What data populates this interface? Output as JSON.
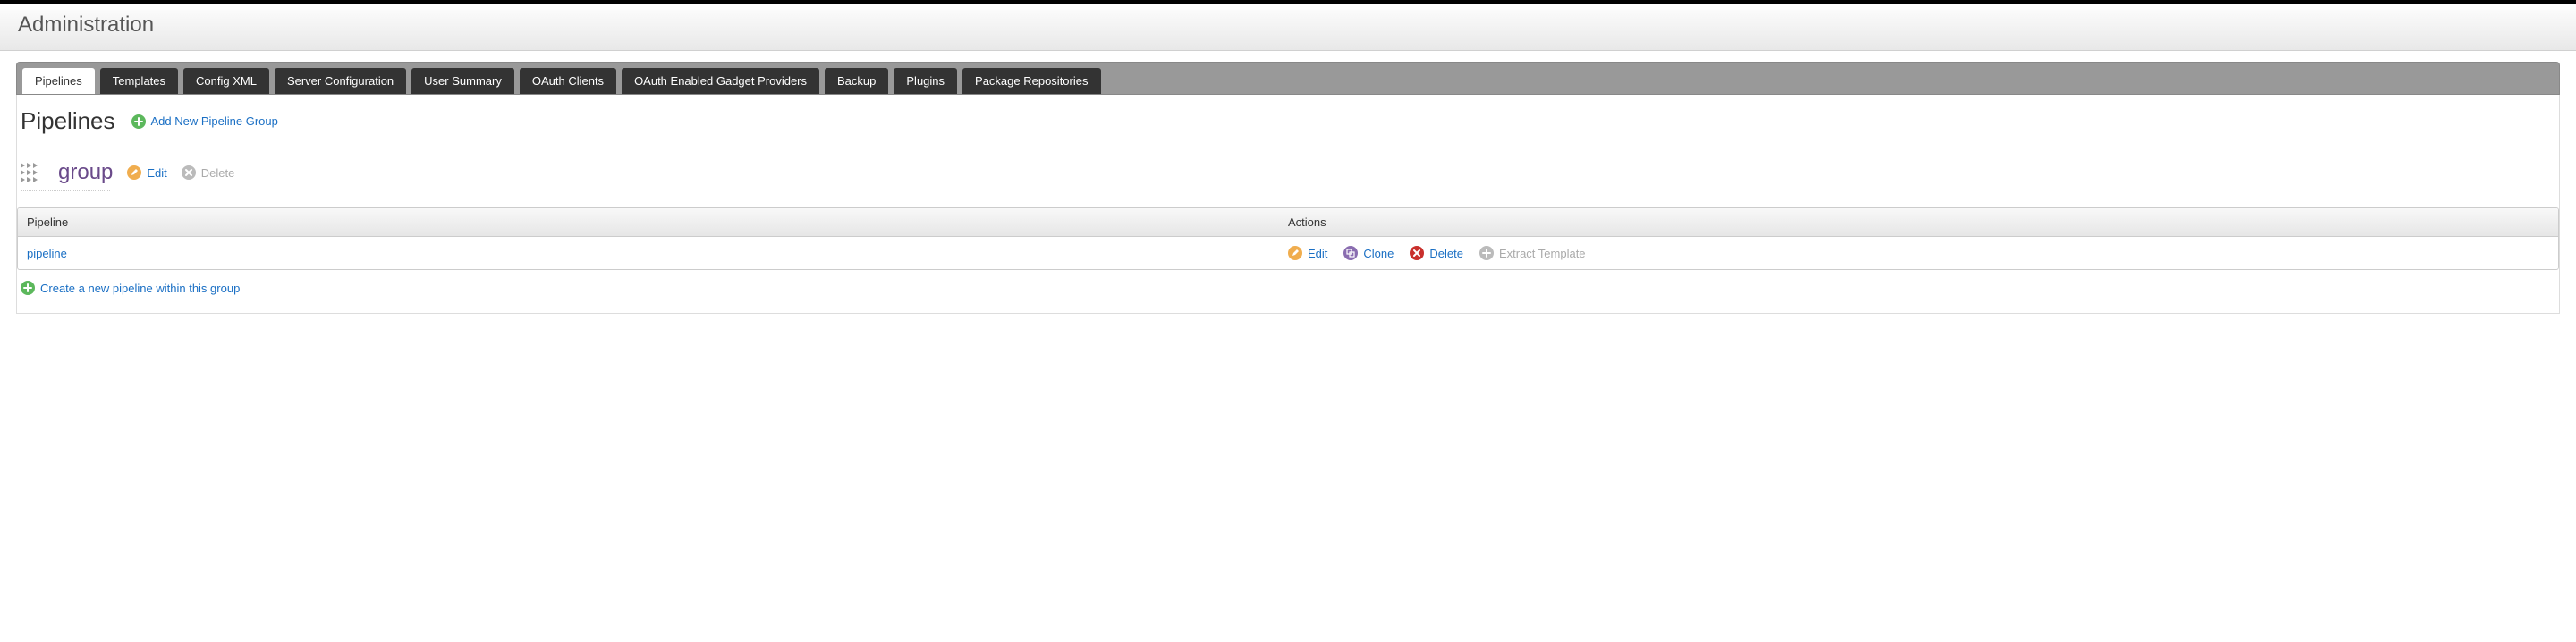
{
  "header": {
    "title": "Administration"
  },
  "tabs": [
    {
      "label": "Pipelines",
      "active": true
    },
    {
      "label": "Templates"
    },
    {
      "label": "Config XML"
    },
    {
      "label": "Server Configuration"
    },
    {
      "label": "User Summary"
    },
    {
      "label": "OAuth Clients"
    },
    {
      "label": "OAuth Enabled Gadget Providers"
    },
    {
      "label": "Backup"
    },
    {
      "label": "Plugins"
    },
    {
      "label": "Package Repositories"
    }
  ],
  "page": {
    "title": "Pipelines",
    "add_group_label": "Add New Pipeline Group"
  },
  "group": {
    "name": "group",
    "edit_label": "Edit",
    "delete_label": "Delete"
  },
  "table": {
    "headers": {
      "pipeline": "Pipeline",
      "actions": "Actions"
    },
    "rows": [
      {
        "name": "pipeline",
        "edit": "Edit",
        "clone": "Clone",
        "delete": "Delete",
        "extract": "Extract Template"
      }
    ]
  },
  "footer": {
    "create_label": "Create a new pipeline within this group"
  }
}
